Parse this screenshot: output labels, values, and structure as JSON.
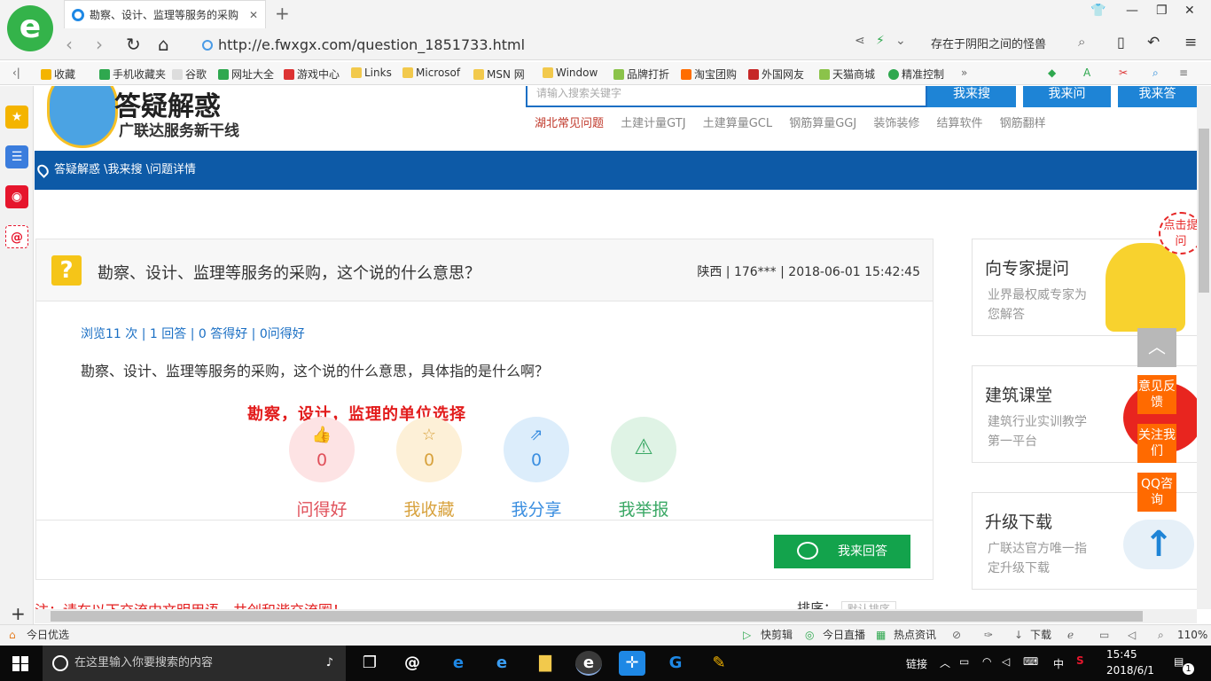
{
  "browser": {
    "tab_title": "勘察、设计、监理等服务的采购",
    "url": "http://e.fwxgx.com/question_1851733.html",
    "search_text": "存在于阴阳之间的怪兽"
  },
  "bookmarks": [
    "收藏",
    "手机收藏夹",
    "谷歌",
    "网址大全",
    "游戏中心",
    "Links",
    "Microsof",
    "MSN 网",
    "Window",
    "品牌打折",
    "淘宝团购",
    "外国网友",
    "天猫商城",
    "精准控制"
  ],
  "site": {
    "brand_title": "答疑解惑",
    "brand_sub": "广联达服务新干线",
    "search_placeholder": "请输入搜索关键字",
    "btn_search": "我来搜",
    "btn_ask": "我来问",
    "btn_answer": "我来答",
    "hot_links": [
      "湖北常见问题",
      "土建计量GTJ",
      "土建算量GCL",
      "钢筋算量GGJ",
      "装饰装修",
      "结算软件",
      "钢筋翻样"
    ],
    "breadcrumb": "答疑解惑 \\我来搜 \\问题详情"
  },
  "question": {
    "title": "勘察、设计、监理等服务的采购，这个说的什么意思？",
    "meta": "陕西 | 176*** | 2018-06-01 15:42:45",
    "stats": "浏览11 次 | 1 回答 | 0 答得好 | 0问得好",
    "body": "勘察、设计、监理等服务的采购，这个说的什么意思，具体指的是什么啊？",
    "answer_note": "勘察，设计，监理的单位选择",
    "actions": [
      {
        "label": "问得好",
        "count": "0",
        "color": "#e0505a",
        "bg": "#fde3e4",
        "icon": "👍"
      },
      {
        "label": "我收藏",
        "count": "0",
        "color": "#d8a23d",
        "bg": "#fdf0d7",
        "icon": "☆"
      },
      {
        "label": "我分享",
        "count": "0",
        "color": "#3a8ee0",
        "bg": "#dcedfb",
        "icon": "⇗"
      },
      {
        "label": "我举报",
        "count": "",
        "color": "#3aa865",
        "bg": "#dff3e5",
        "icon": "⚠"
      }
    ],
    "answer_button": "我来回答",
    "notice": "注：请在以下交流中文明用语，共创和谐交流圈！",
    "sort_label": "排序：",
    "sort_value": "默认排序"
  },
  "sidebar_cards": [
    {
      "title": "向专家提问",
      "sub": "业界最权威专家为您解答"
    },
    {
      "title": "建筑课堂",
      "sub": "建筑行业实训教学第一平台"
    },
    {
      "title": "升级下载",
      "sub": "广联达官方唯一指定升级下载"
    }
  ],
  "float_buttons": [
    "意见反馈",
    "关注我们",
    "QQ咨询"
  ],
  "badge_text": "点击提问",
  "status_bar": {
    "left": "今日优选",
    "items": [
      "快剪辑",
      "今日直播",
      "热点资讯",
      "下载"
    ],
    "zoom": "110%"
  },
  "taskbar": {
    "search_placeholder": "在这里输入你要搜索的内容",
    "link_label": "链接",
    "ime": "中",
    "time": "15:45",
    "date": "2018/6/1",
    "notif_count": "1"
  }
}
